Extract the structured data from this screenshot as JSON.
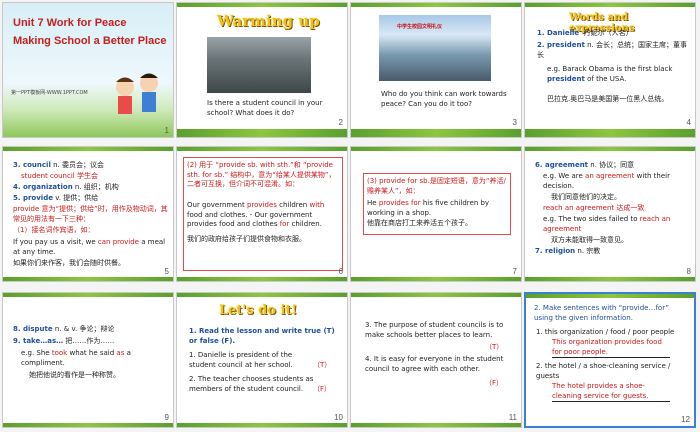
{
  "slides": [
    {
      "number": "1",
      "title_line1": "Unit 7  Work for Peace",
      "title_line2": "Making School a Better Place",
      "footer": "第一PPT模板网-WWW.1PPT.COM"
    },
    {
      "number": "2",
      "heading": "Warming up",
      "question": "Is there a student council in your school? What does it do?"
    },
    {
      "number": "3",
      "banner": "中学生校园文明礼仪",
      "question": "Who do you think can work towards peace? Can you do it too?"
    },
    {
      "number": "4",
      "heading": "Words and expressions",
      "l1a": "1. Danielle",
      "l1b": "丹妮尔（人名）",
      "l2a": "2. president",
      "l2b": "n. 会长；总统；国家主席；董事长",
      "l3": "e.g. Barack Obama is the first black",
      "l3b": "president",
      "l3c": "of the USA.",
      "l4": "巴拉克.奥巴马是美国第一位黑人总统。"
    },
    {
      "number": "5",
      "l1a": "3. council",
      "l1b": "n. 委员会；议会",
      "l1c": "student council 学生会",
      "l2a": "4. organization",
      "l2b": "n. 组织；机构",
      "l3a": "5. provide",
      "l3b": "v. 提供；供给",
      "l4": "provide 意为“提供；供给”时，用作及物动词，其常见的用法有一下三种：",
      "l5": "（1）接名词作宾语，如：",
      "l6a": "If you pay us a visit, we",
      "l6b": "can provide",
      "l6c": "a meal at any time.",
      "l7": "如果你们来作客，我们会随时供餐。"
    },
    {
      "number": "6",
      "l1": "(2) 用于 “provide sb. with sth.”和 “provide sth. for sb.” 结构中，意为“给某人提供某物”，二者可互换，但介词不可混淆。如：",
      "l2a": "Our government",
      "l2b": "provides",
      "l2c": "children",
      "l2d": "with",
      "l2e": "food and clothes. - Our government provides food",
      "l2f": "and clothes",
      "l2g": "for",
      "l2h": "children.",
      "l3": "我们的政府给孩子们提供食物和衣服。"
    },
    {
      "number": "7",
      "l1": "(3) provide for sb.是固定短语，意为“养活/赡养某人”，如：",
      "l2a": "He",
      "l2b": "provides for",
      "l2c": "his five children by working in a shop.",
      "l3": "他靠在商店打工来养活五个孩子。"
    },
    {
      "number": "8",
      "l1a": "6. agreement",
      "l1b": "n. 协议；同意",
      "l2a": "e.g. We are",
      "l2b": "an agreement",
      "l2c": "with their decision.",
      "l3": "我们同意他们的决定。",
      "l4": "reach an agreement 达成一致",
      "l5a": "e.g. The two sides failed to",
      "l5b": "reach an agreement",
      "l6": "双方未能取得一致意见。",
      "l7a": "7. religion",
      "l7b": "n. 宗教"
    },
    {
      "number": "9",
      "l1a": "8. dispute",
      "l1b": "n. & v. 争论；辩论",
      "l2a": "9. take…as…",
      "l2b": "把……作为……",
      "l3a": "e.g. She",
      "l3b": "took",
      "l3c": "what he said",
      "l3d": "as",
      "l3e": "a compliment.",
      "l4": "她把他说的看作是一种称赞。"
    },
    {
      "number": "10",
      "heading": "Let's do it!",
      "l1": "1. Read the lesson and write true (T) or false (F).",
      "l2": "1. Danielle is president of the student council at her school.",
      "a2": "（T）",
      "l3": "2. The teacher chooses students as members of the student council.",
      "a3": "（F）"
    },
    {
      "number": "11",
      "l1": "3. The purpose of student councils is to make schools better places to learn.",
      "a1": "（T）",
      "l2": "4. It is easy for everyone in the student council to agree with each other.",
      "a2": "（F）"
    },
    {
      "number": "12",
      "l1": "2. Make sentences with “provide…for” using the given information.",
      "l2": "1. this organization / food / poor people",
      "a2": "This organization provides food for poor people.",
      "l3": "2. the hotel / a shoe-cleaning service / guests",
      "a3": "The hotel provides a shoe-cleaning service for guests."
    }
  ]
}
